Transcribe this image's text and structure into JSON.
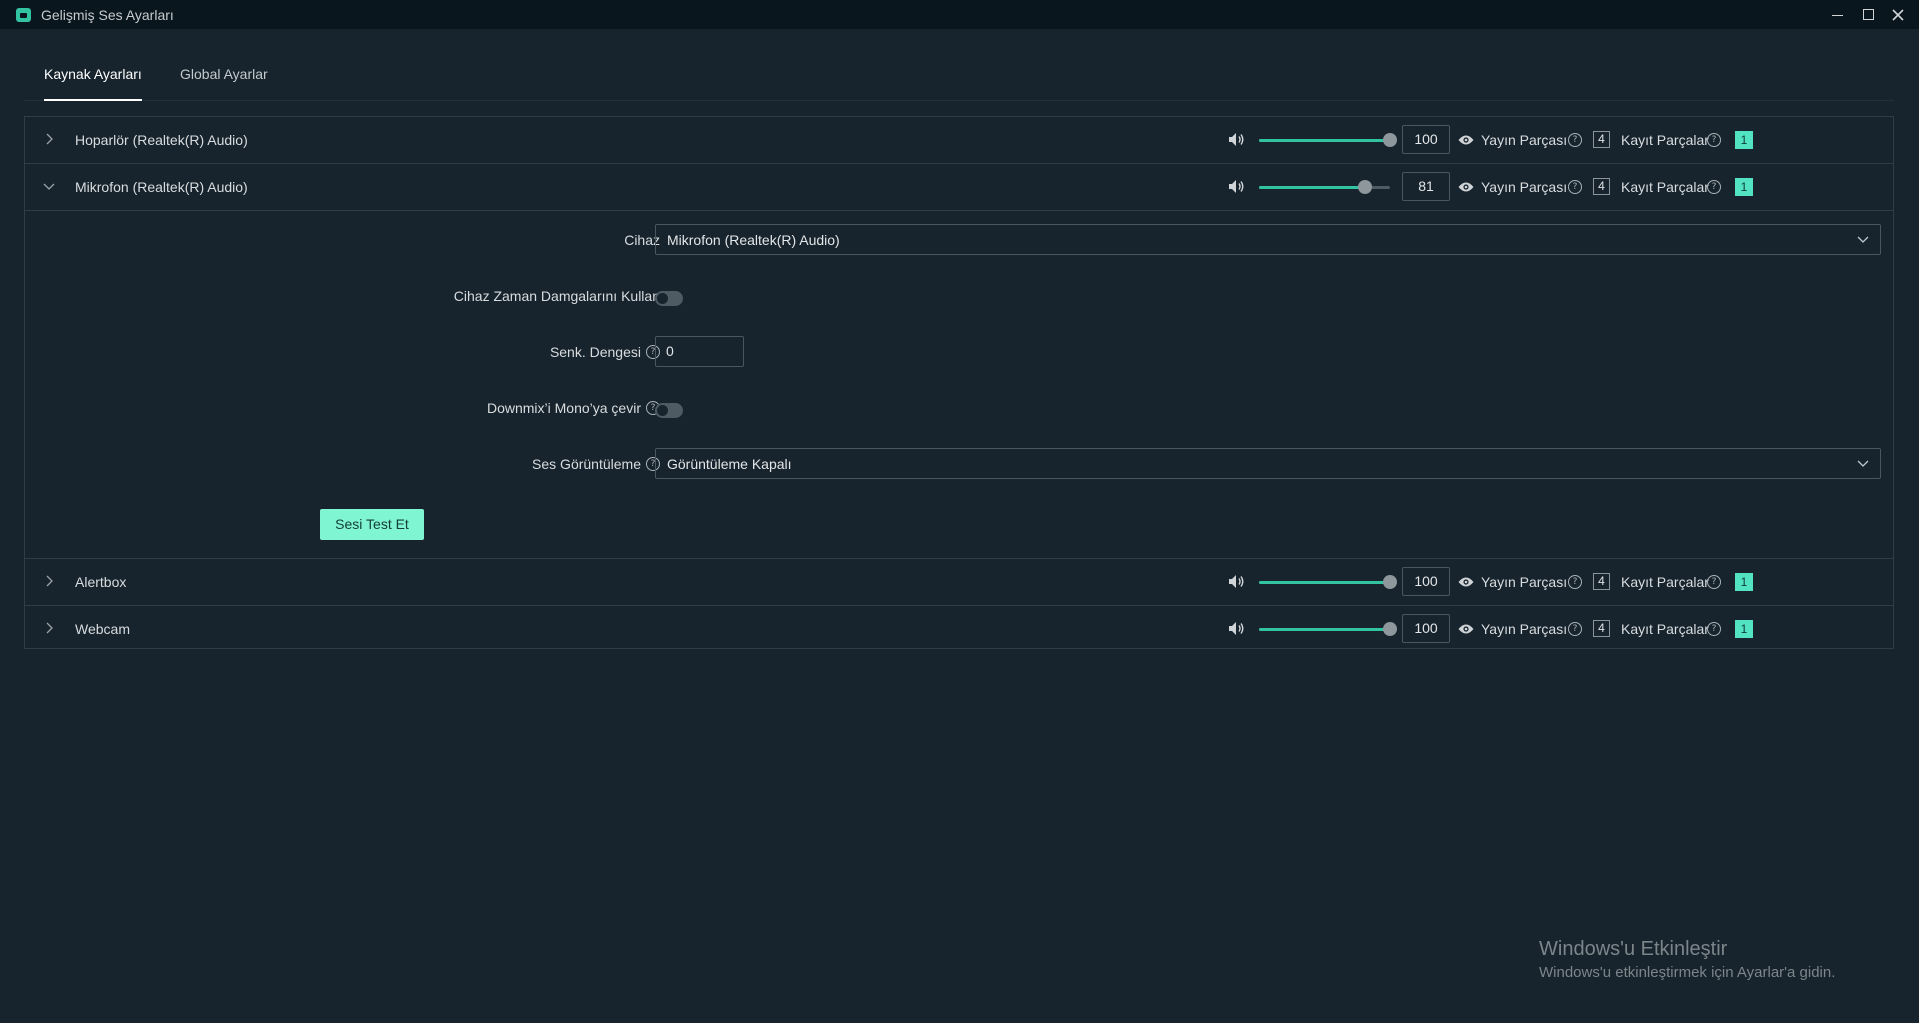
{
  "window": {
    "title": "Gelişmiş Ses Ayarları",
    "controls": [
      "minimize-icon",
      "maximize-icon",
      "close-icon"
    ]
  },
  "tabs": [
    {
      "label": "Kaynak Ayarları",
      "active": true
    },
    {
      "label": "Global Ayarlar",
      "active": false
    }
  ],
  "common": {
    "stream_label": "Yayın Parçası",
    "record_label": "Kayıt Parçalar",
    "help_glyph": "?"
  },
  "sources": [
    {
      "name": "Hoparlör (Realtek(R) Audio)",
      "volume": "100",
      "level": 100,
      "stream_track": "4",
      "record_track": "1",
      "expanded": false
    },
    {
      "name": "Mikrofon (Realtek(R) Audio)",
      "volume": "81",
      "level": 81,
      "stream_track": "4",
      "record_track": "1",
      "expanded": true
    },
    {
      "name": "Alertbox",
      "volume": "100",
      "level": 100,
      "stream_track": "4",
      "record_track": "1",
      "expanded": false
    },
    {
      "name": "Webcam",
      "volume": "100",
      "level": 100,
      "stream_track": "4",
      "record_track": "1",
      "expanded": false
    }
  ],
  "mic_settings": {
    "device_label": "Cihaz",
    "device_value": "Mikrofon (Realtek(R) Audio)",
    "timestamps_label": "Cihaz Zaman Damgalarını Kullan",
    "timestamps_on": false,
    "sync_offset_label": "Senk. Dengesi",
    "sync_offset_value": "0",
    "downmix_label": "Downmix’i Mono’ya çevir",
    "downmix_on": false,
    "monitoring_label": "Ses Görüntüleme",
    "monitoring_value": "Görüntüleme Kapalı",
    "test_button": "Sesi Test Et"
  },
  "watermark": {
    "title": "Windows'u Etkinleştir",
    "subtitle": "Windows'u etkinleştirmek için Ayarlar'a gidin."
  },
  "colors": {
    "accent": "#31c3a2",
    "button": "#80f5d2",
    "background": "#17242d",
    "titlebar": "#09161d"
  }
}
